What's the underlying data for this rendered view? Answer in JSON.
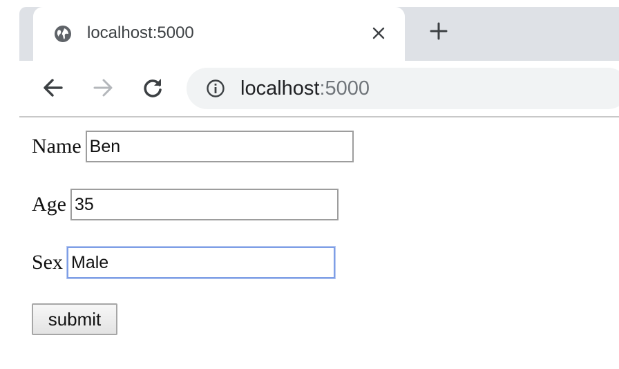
{
  "browser": {
    "tab": {
      "title": "localhost:5000",
      "favicon": "globe-icon"
    },
    "new_tab_icon": "plus-icon",
    "toolbar": {
      "back_icon": "arrow-left-icon",
      "forward_icon": "arrow-right-icon",
      "reload_icon": "reload-icon",
      "site_info_icon": "info-icon"
    },
    "address_bar": {
      "host": "localhost",
      "port": ":5000"
    }
  },
  "form": {
    "fields": [
      {
        "label": "Name",
        "value": "Ben"
      },
      {
        "label": "Age",
        "value": "35"
      },
      {
        "label": "Sex",
        "value": "Male",
        "focused": true
      }
    ],
    "submit_label": "submit"
  },
  "colors": {
    "tabstrip": "#dee1e6",
    "omnibox": "#f1f3f4",
    "focus_ring": "#7e9ee6"
  }
}
